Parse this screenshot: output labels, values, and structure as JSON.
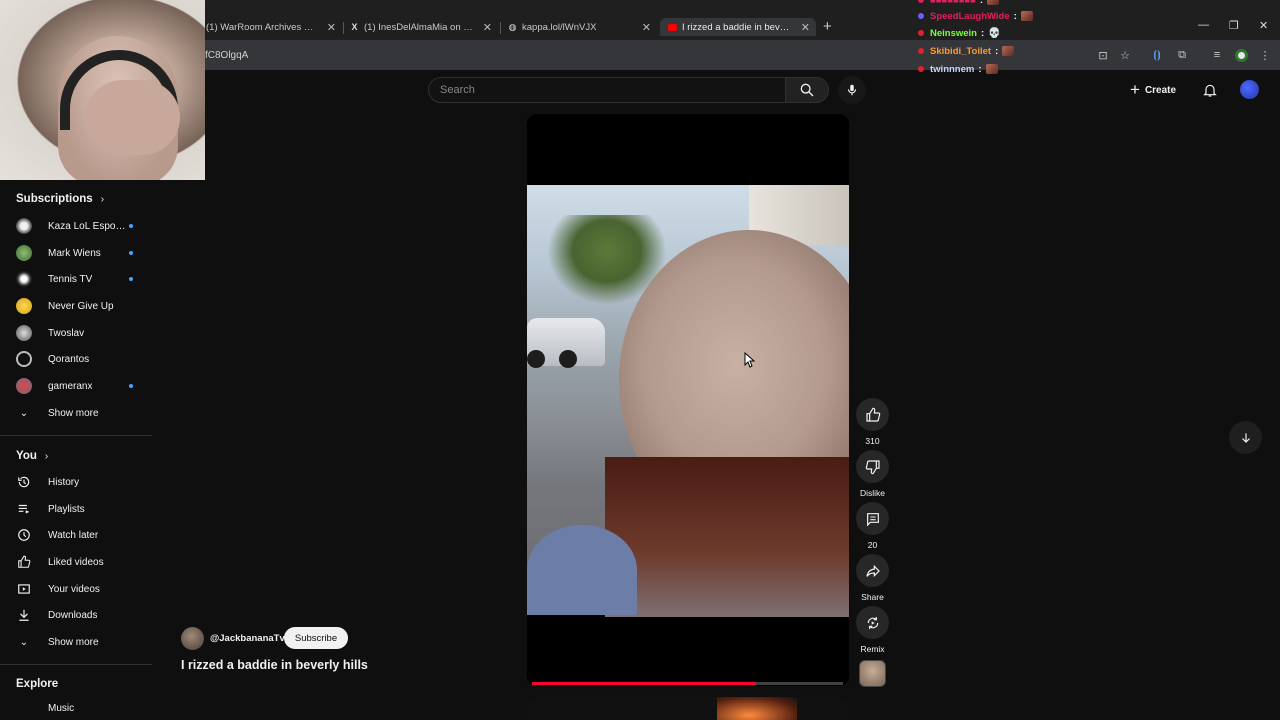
{
  "browser": {
    "tabs": [
      {
        "title": "(1) WarRoom Archives on X: \"F…",
        "icon": "x-logo-icon"
      },
      {
        "title": "(1) InesDelAlmaMia on X: \"Q…",
        "icon": "x-logo-icon"
      },
      {
        "title": "kappa.lol/lWnVJX",
        "icon": "globe-icon"
      },
      {
        "title": "I rizzed a baddie in beverly hills",
        "icon": "youtube-icon",
        "active": true
      }
    ],
    "url_fragment": "fC8OlgqA"
  },
  "chat": [
    {
      "user": "SpeedLaughWide",
      "color": "#e0205a",
      "emote": "emote-image"
    },
    {
      "user": "Neinswein",
      "color": "#7cfc3a",
      "emote": "skull-emote"
    },
    {
      "user": "Skibidi_Toilet",
      "color": "#ff9a2e",
      "emote": "emote-image"
    },
    {
      "user": "twinnnem",
      "color": "#c9d6ff",
      "emote": "emote-image"
    }
  ],
  "header": {
    "search_placeholder": "Search",
    "create_label": "Create"
  },
  "sidebar": {
    "subscriptions_title": "Subscriptions",
    "subscriptions": [
      {
        "name": "Kaza LoL Esport…",
        "new": true
      },
      {
        "name": "Mark Wiens",
        "new": true
      },
      {
        "name": "Tennis TV",
        "new": true
      },
      {
        "name": "Never Give Up",
        "new": false
      },
      {
        "name": "Twoslav",
        "new": false
      },
      {
        "name": "Qorantos",
        "new": false
      },
      {
        "name": "gameranx",
        "new": true
      }
    ],
    "show_more_1": "Show more",
    "you_title": "You",
    "you_items": [
      {
        "label": "History",
        "icon": "history-icon"
      },
      {
        "label": "Playlists",
        "icon": "playlists-icon"
      },
      {
        "label": "Watch later",
        "icon": "watch-later-icon"
      },
      {
        "label": "Liked videos",
        "icon": "like-icon"
      },
      {
        "label": "Your videos",
        "icon": "your-videos-icon"
      },
      {
        "label": "Downloads",
        "icon": "download-icon"
      }
    ],
    "show_more_2": "Show more",
    "explore_title": "Explore",
    "explore_partial": "Music"
  },
  "video": {
    "channel": "@JackbananaTv",
    "subscribe_label": "Subscribe",
    "title": "I rizzed a baddie in beverly hills",
    "progress": 0.72
  },
  "actions": {
    "likes": "310",
    "dislike_label": "Dislike",
    "comments": "20",
    "share_label": "Share",
    "remix_label": "Remix"
  }
}
